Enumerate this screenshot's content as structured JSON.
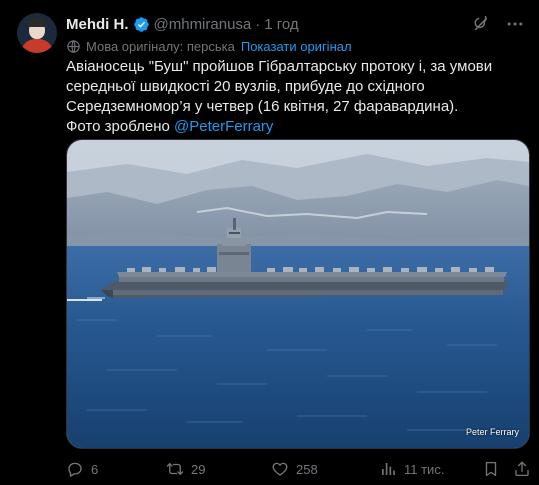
{
  "author": {
    "name": "Mehdi H.",
    "handle": "@mhmiranusa",
    "separator": "·",
    "time": "1 год"
  },
  "translation": {
    "note": "Мова оригіналу: перська",
    "show_original": "Показати оригінал"
  },
  "text": {
    "body": "Авіаносець \"Буш\" пройшов Гібралтарську протоку і, за умови середньої швидкості 20 вузлів, прибуде до східного Середземномор’я у четвер (16 квітня, 27 фаравардина).",
    "photo_prefix": "Фото зроблено ",
    "photo_mention": "@PeterFerrary"
  },
  "media": {
    "watermark": "Peter Ferrary"
  },
  "stats": {
    "replies": "6",
    "reposts": "29",
    "likes": "258",
    "views": "11 тис."
  },
  "colors": {
    "background": "#000000",
    "text": "#e7e9ea",
    "muted": "#71767b",
    "accent": "#1d9bf0"
  },
  "icons": [
    "verified-icon",
    "grok-icon",
    "more-icon",
    "translate-icon",
    "reply-icon",
    "repost-icon",
    "like-icon",
    "views-icon",
    "bookmark-icon",
    "share-icon"
  ]
}
